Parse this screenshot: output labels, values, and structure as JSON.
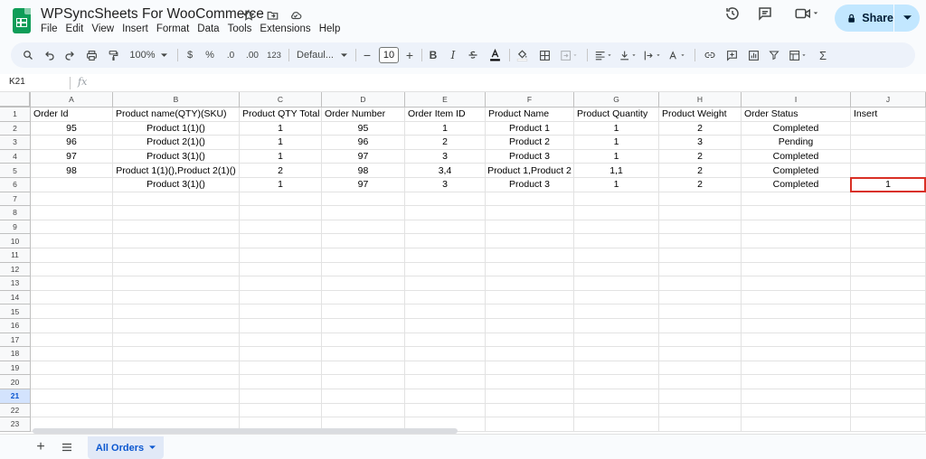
{
  "doc": {
    "title": "WPSyncSheets For WooCommerce"
  },
  "menu": [
    "File",
    "Edit",
    "View",
    "Insert",
    "Format",
    "Data",
    "Tools",
    "Extensions",
    "Help"
  ],
  "share_label": "Share",
  "toolbar": {
    "zoom": "100%",
    "currency": "$",
    "percent": "%",
    "dec_decrease": ".0",
    "dec_increase": ".00",
    "number_format": "123",
    "font": "Defaul...",
    "font_size": "10",
    "bold": "B",
    "italic": "I"
  },
  "formula_bar": {
    "cell_ref": "K21",
    "fx": "fx"
  },
  "columns": [
    "A",
    "B",
    "C",
    "D",
    "E",
    "F",
    "G",
    "H",
    "I",
    "J"
  ],
  "rows": [
    [
      "Order Id",
      "Product name(QTY)(SKU)",
      "Product QTY Total",
      "Order Number",
      "Order Item ID",
      "Product Name",
      "Product Quantity",
      "Product Weight",
      "Order Status",
      "Insert"
    ],
    [
      "95",
      "Product 1(1)()",
      "1",
      "95",
      "1",
      "Product 1",
      "1",
      "2",
      "Completed",
      ""
    ],
    [
      "96",
      "Product 2(1)()",
      "1",
      "96",
      "2",
      "Product 2",
      "1",
      "3",
      "Pending",
      ""
    ],
    [
      "97",
      "Product 3(1)()",
      "1",
      "97",
      "3",
      "Product 3",
      "1",
      "2",
      "Completed",
      ""
    ],
    [
      "98",
      "Product 1(1)(),Product 2(1)()",
      "2",
      "98",
      "3,4",
      "Product 1,Product 2",
      "1,1",
      "2",
      "Completed",
      ""
    ],
    [
      "",
      "Product 3(1)()",
      "1",
      "97",
      "3",
      "Product 3",
      "1",
      "2",
      "Completed",
      "1"
    ]
  ],
  "row_numbers": [
    "1",
    "2",
    "3",
    "4",
    "5",
    "6",
    "7",
    "8",
    "9",
    "10",
    "11",
    "12",
    "13",
    "14",
    "15",
    "16",
    "17",
    "18",
    "19",
    "20",
    "21",
    "22",
    "23"
  ],
  "selected_row": "21",
  "sheet_tab": {
    "label": "All Orders"
  },
  "colors": {
    "accent": "#0b57d0",
    "share_bg": "#c2e7ff",
    "selection_border": "#d93025",
    "logo": "#0f9d58"
  }
}
